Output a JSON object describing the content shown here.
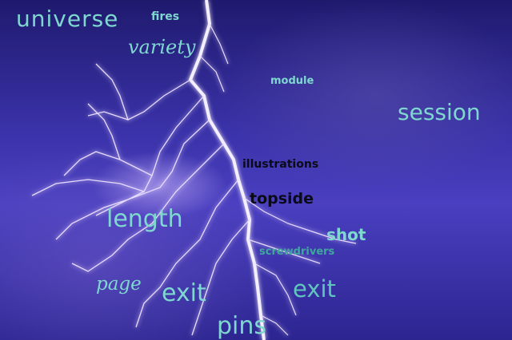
{
  "words": {
    "universe": "universe",
    "fires": "fires",
    "variety": "variety",
    "module": "module",
    "session": "session",
    "illustrations": "illustrations",
    "topside": "topside",
    "length": "length",
    "shot": "shot",
    "screwdrivers": "screwdrivers",
    "page": "page",
    "exit_left": "exit",
    "exit_right": "exit",
    "pins": "pins"
  },
  "colors": {
    "sky_top": "#1f1a6e",
    "sky_mid": "#4a3fc0",
    "bolt": "#f4efff",
    "text_teal": "#7fd8d0",
    "text_dark": "#0a0a18"
  }
}
